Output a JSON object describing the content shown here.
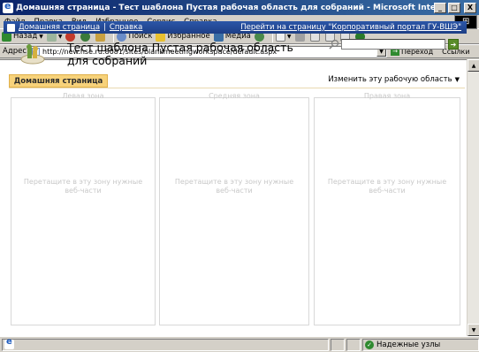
{
  "window": {
    "title": "Домашняя страница - Тест шаблона Пустая рабочая область для собраний - Microsoft Internet Explorer",
    "minimize": "_",
    "maximize": "□",
    "close": "X"
  },
  "menu": {
    "items": [
      "Файл",
      "Правка",
      "Вид",
      "Избранное",
      "Сервис",
      "Справка"
    ]
  },
  "toolbar": {
    "back_label": "Назад",
    "search_label": "Поиск",
    "favorites_label": "Избранное",
    "media_label": "Медиа"
  },
  "address": {
    "label": "Адрес",
    "url": "http://new.hse.ru:8081/sites/blankmeetingworkspace/default.aspx",
    "go_label": "Переход",
    "links_label": "Ссылки"
  },
  "page": {
    "topnav": {
      "home_link": "Домашняя страница",
      "help_link": "Справка",
      "goto_link": "Перейти на страницу \"Корпоративный портал ГУ-ВШЭ\""
    },
    "site_title": "Тест шаблона Пустая рабочая область для собраний",
    "home_tab": "Домашняя страница",
    "edit_workspace": "Изменить эту рабочую область",
    "zones": [
      {
        "header": "Левая зона",
        "message": "Перетащите в эту зону нужные веб-части"
      },
      {
        "header": "Средняя зона",
        "message": "Перетащите в эту зону нужные веб-части"
      },
      {
        "header": "Правая зона",
        "message": "Перетащите в эту зону нужные веб-части"
      }
    ]
  },
  "status": {
    "zone_text": "Надежные узлы"
  },
  "colors": {
    "titlebar": "#0a246a",
    "topnav": "#2b56a8",
    "home_tab": "#f7d27a"
  }
}
